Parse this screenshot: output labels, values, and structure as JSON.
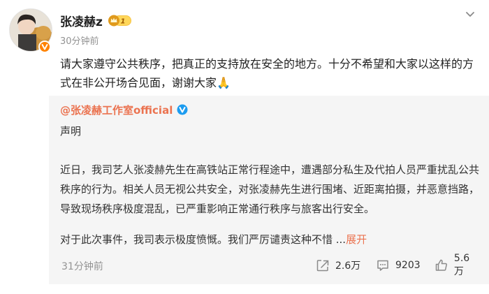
{
  "post": {
    "user_name": "张凌赫z",
    "vip_level": "1",
    "time": "30分钟前",
    "text": "请大家遵守公共秩序，把真正的支持放在安全的地方。十分不希望和大家以这样的方式在非公开场合见面，谢谢大家🙏"
  },
  "repost": {
    "author": "@张凌赫工作室official",
    "title": "声明",
    "paragraph1": "近日，我司艺人张凌赫先生在高铁站正常行程途中，遭遇部分私生及代拍人员严重扰乱公共秩序的行为。相关人员无视公共安全，对张凌赫先生进行围堵、近距离拍摄，并恶意挡路，导致现场秩序极度混乱，已严重影响正常通行秩序与旅客出行安全。",
    "paragraph2": "对于此次事件，我司表示极度愤慨。我们严厉谴责这种不惜 ...",
    "expand_label": "展开",
    "time": "31分钟前",
    "stats": {
      "shares": "2.6万",
      "comments": "9203",
      "likes": "5.6万"
    }
  },
  "icons": {
    "more": "chevron-down-icon",
    "share": "share-icon",
    "comment": "comment-icon",
    "like": "thumbs-up-icon",
    "verified": "verified-v-icon"
  },
  "colors": {
    "link": "#eb7350",
    "meta": "#939393",
    "card_bg": "#f5f5f5",
    "badge_orange": "#ff8200"
  }
}
